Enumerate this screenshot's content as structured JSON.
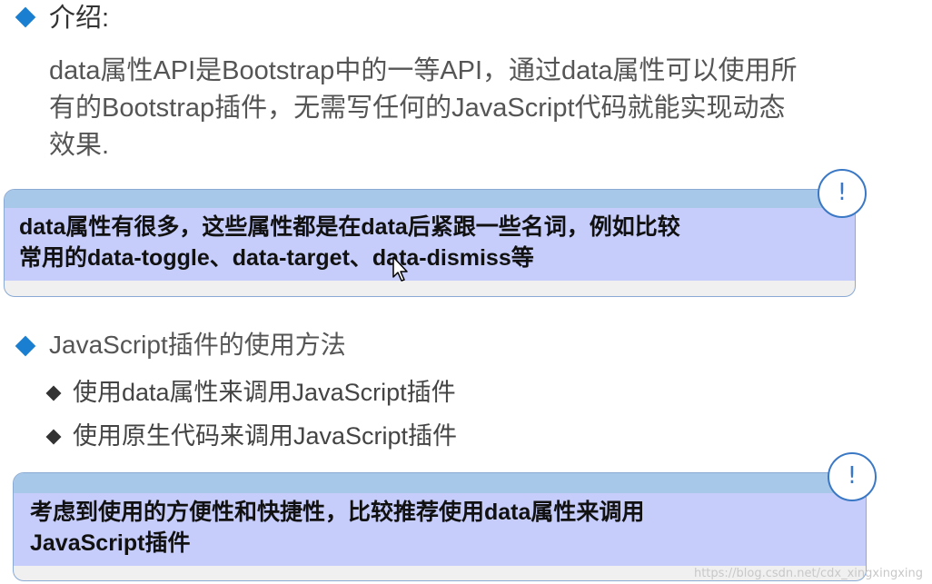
{
  "intro": {
    "heading": "介绍:",
    "lines": [
      "data属性API是Bootstrap中的一等API，通过data属性可以使用所",
      "有的Bootstrap插件，无需写任何的JavaScript代码就能实现动态",
      "效果."
    ]
  },
  "note1": {
    "badge": "!",
    "lines": [
      "data属性有很多，这些属性都是在data后紧跟一些名词，例如比较",
      "常用的data-toggle、data-target、data-dismiss等"
    ]
  },
  "usage": {
    "heading": "JavaScript插件的使用方法",
    "items": [
      "使用data属性来调用JavaScript插件",
      "使用原生代码来调用JavaScript插件"
    ]
  },
  "note2": {
    "badge": "!",
    "lines": [
      "考虑到使用的方便性和快捷性，比较推荐使用data属性来调用",
      "JavaScript插件"
    ]
  },
  "watermark": "https://blog.csdn.net/cdx_xingxingxing",
  "colors": {
    "bullet": "#1a7fd0",
    "note_body": "#c6cdfa",
    "note_strip": "#a7c8e8",
    "badge": "#3a78c5"
  }
}
